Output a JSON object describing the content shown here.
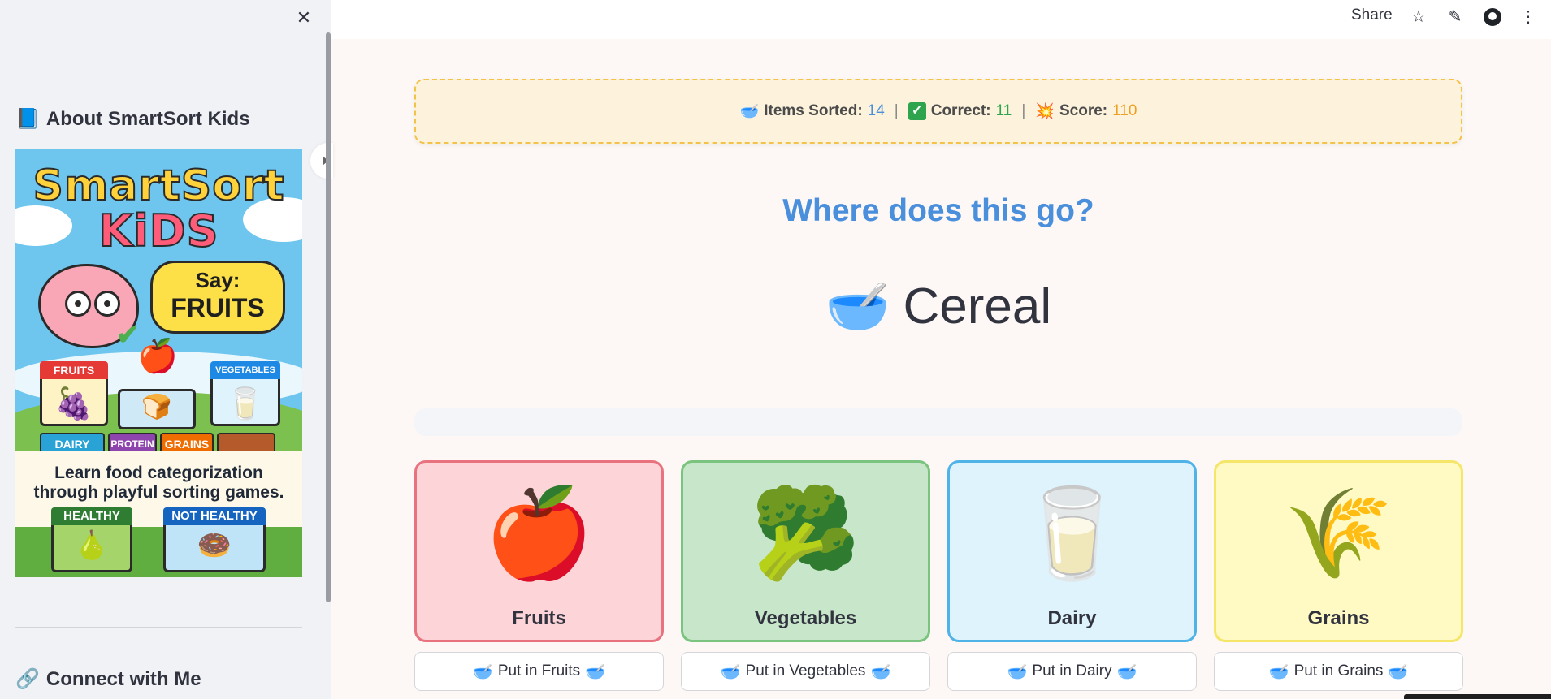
{
  "sidebar": {
    "about_emoji": "📘",
    "about_heading": "About SmartSort Kids",
    "connect_emoji": "🔗",
    "connect_heading": "Connect with Me",
    "close_glyph": "✕",
    "poster": {
      "title_line1": "SmartSort",
      "title_line2": "KiDS",
      "bubble_line1": "Say:",
      "bubble_line2": "FRUITS",
      "check": "✔",
      "apple": "🍎",
      "fruits_tag": "FRUITS",
      "fruits_emoji": "🍇",
      "vegetables_tag": "VEGETABLES",
      "vegetables_emoji": "🥛",
      "middle_emoji": "🍞",
      "dairy_tag": "DAIRY",
      "protein_tag": "PROTEIN",
      "grains_tag": "GRAINS",
      "subtitle_line1": "Learn food categorization",
      "subtitle_line2": "through playful sorting games.",
      "healthy_tag": "HEALTHY",
      "healthy_emoji": "🍐",
      "not_healthy_tag": "NOT HEALTHY",
      "not_healthy_emoji": "🍩"
    }
  },
  "toolbar": {
    "share_label": "Share",
    "star_glyph": "☆",
    "edit_glyph": "✎",
    "menu_glyph": "⋮"
  },
  "stats": {
    "sorted_emoji": "🥣",
    "sorted_label": "Items Sorted:",
    "sorted_value": "14",
    "correct_emoji": "✓",
    "correct_label": "Correct:",
    "correct_value": "11",
    "score_emoji": "💥",
    "score_label": "Score:",
    "score_value": "110",
    "separator": "|"
  },
  "game": {
    "question": "Where does this go?",
    "item_emoji": "🥣",
    "item_name": "Cereal",
    "bin_emoji": "🥣"
  },
  "categories": [
    {
      "name": "Fruits",
      "emoji": "🍎",
      "button": "Put in Fruits",
      "bg": "#fdd5d9",
      "border": "#e8737f"
    },
    {
      "name": "Vegetables",
      "emoji": "🥦",
      "button": "Put in Vegetables",
      "bg": "#c8e6c9",
      "border": "#7bc47f"
    },
    {
      "name": "Dairy",
      "emoji": "🥛",
      "button": "Put in Dairy",
      "bg": "#dff3fc",
      "border": "#4fb3e8"
    },
    {
      "name": "Grains",
      "emoji": "🌾",
      "button": "Put in Grains",
      "bg": "#fff9c4",
      "border": "#f5e66a"
    }
  ]
}
